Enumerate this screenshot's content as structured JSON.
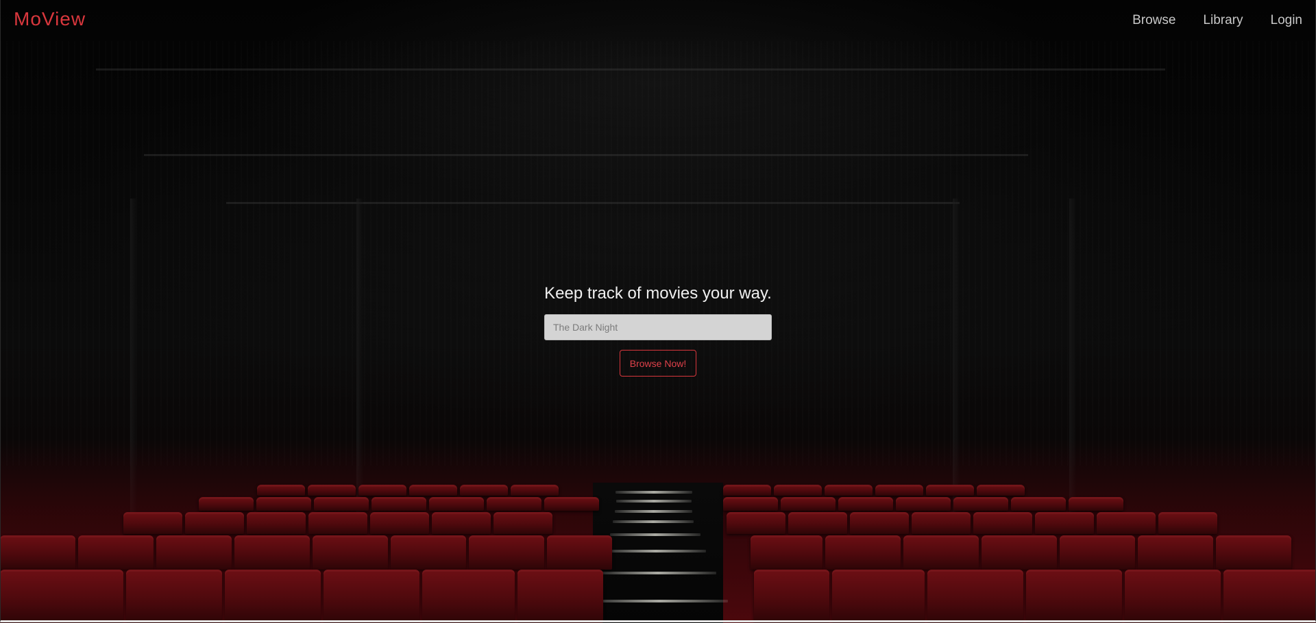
{
  "app": {
    "logo": "MoView"
  },
  "nav": {
    "items": [
      {
        "label": "Browse"
      },
      {
        "label": "Library"
      },
      {
        "label": "Login"
      }
    ]
  },
  "hero": {
    "title": "Keep track of movies your way.",
    "search": {
      "placeholder": "The Dark Night",
      "value": ""
    },
    "button_label": "Browse Now!"
  },
  "theme": {
    "accent": "#d9373d",
    "background": "#000000",
    "nav_text": "#c9c9c9",
    "input_background": "#d4d4d4"
  }
}
